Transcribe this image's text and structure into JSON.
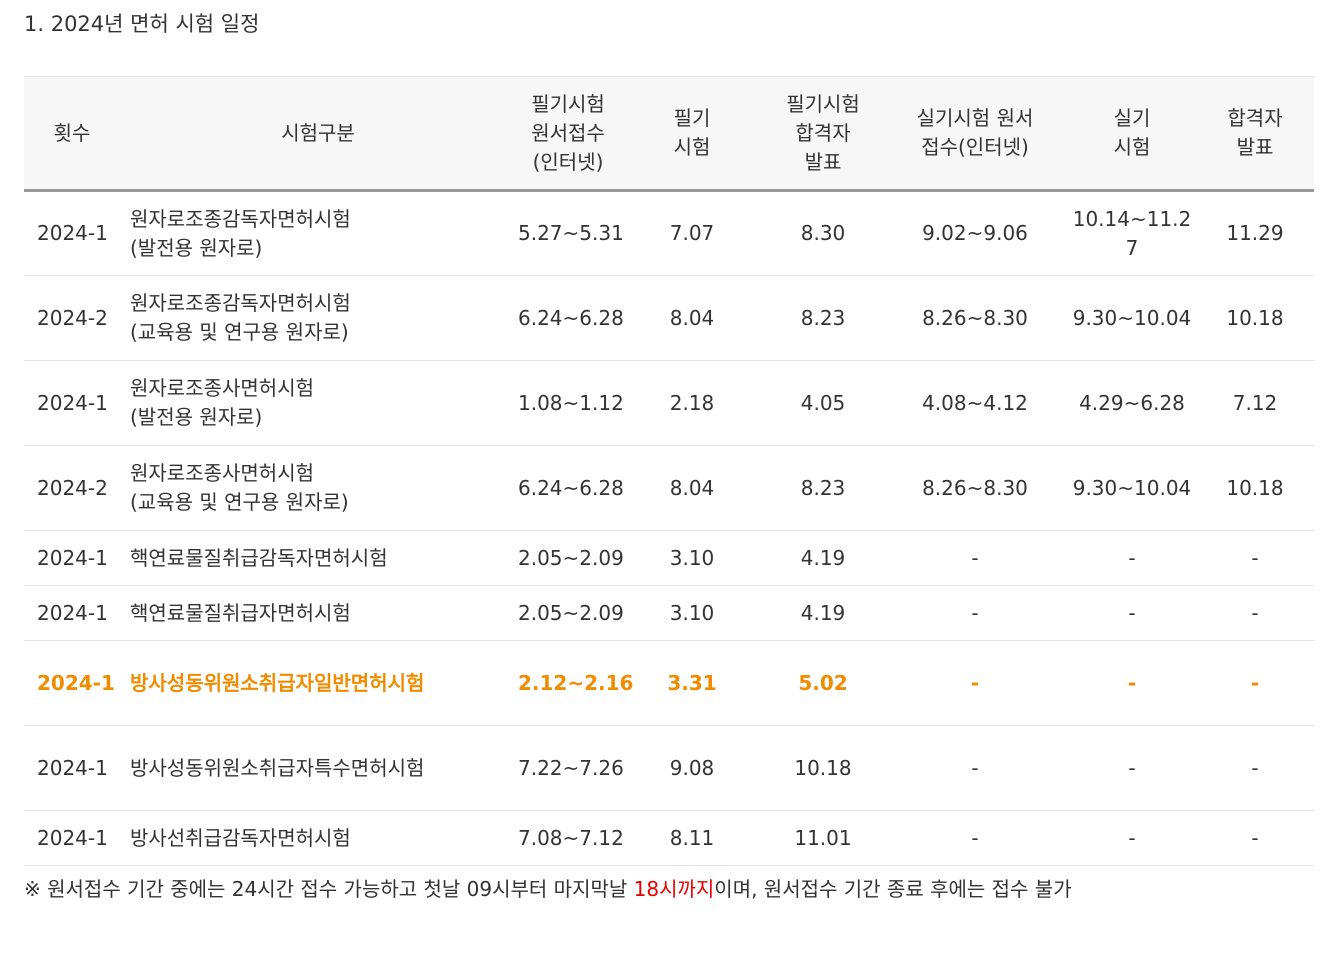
{
  "title": "1. 2024년 면허 시험 일정",
  "table": {
    "headers": {
      "round": "횟수",
      "type": "시험구분",
      "written_apply_l1": "필기시험",
      "written_apply_l2": "원서접수",
      "written_apply_l3": "(인터넷)",
      "written_exam_l1": "필기",
      "written_exam_l2": "시험",
      "written_result_l1": "필기시험",
      "written_result_l2": "합격자",
      "written_result_l3": "발표",
      "practical_apply_l1": "실기시험 원서",
      "practical_apply_l2": "접수(인터넷)",
      "practical_exam_l1": "실기",
      "practical_exam_l2": "시험",
      "final_result_l1": "합격자",
      "final_result_l2": "발표"
    },
    "rows": [
      {
        "round": "2024-1",
        "type1": "원자로조종감독자면허시험",
        "type2": "(발전용 원자로)",
        "written_apply": "5.27~5.31",
        "written_exam": "7.07",
        "written_result": "8.30",
        "practical_apply": "9.02~9.06",
        "practical_exam_l1": "10.14~11.2",
        "practical_exam_l2": "7",
        "final_result": "11.29"
      },
      {
        "round": "2024-2",
        "type1": "원자로조종감독자면허시험",
        "type2": "(교육용 및 연구용 원자로)",
        "written_apply": "6.24~6.28",
        "written_exam": "8.04",
        "written_result": "8.23",
        "practical_apply": "8.26~8.30",
        "practical_exam_l1": "9.30~10.04",
        "practical_exam_l2": "",
        "final_result": "10.18"
      },
      {
        "round": "2024-1",
        "type1": "원자로조종사면허시험",
        "type2": "(발전용 원자로)",
        "written_apply": "1.08~1.12",
        "written_exam": "2.18",
        "written_result": "4.05",
        "practical_apply": "4.08~4.12",
        "practical_exam_l1": "4.29~6.28",
        "practical_exam_l2": "",
        "final_result": "7.12"
      },
      {
        "round": "2024-2",
        "type1": "원자로조종사면허시험",
        "type2": "(교육용 및 연구용 원자로)",
        "written_apply": "6.24~6.28",
        "written_exam": "8.04",
        "written_result": "8.23",
        "practical_apply": "8.26~8.30",
        "practical_exam_l1": "9.30~10.04",
        "practical_exam_l2": "",
        "final_result": "10.18"
      },
      {
        "round": "2024-1",
        "type1": "핵연료물질취급감독자면허시험",
        "type2": "",
        "written_apply": "2.05~2.09",
        "written_exam": "3.10",
        "written_result": "4.19",
        "practical_apply": "-",
        "practical_exam_l1": "-",
        "practical_exam_l2": "",
        "final_result": "-"
      },
      {
        "round": "2024-1",
        "type1": "핵연료물질취급자면허시험",
        "type2": "",
        "written_apply": "2.05~2.09",
        "written_exam": "3.10",
        "written_result": "4.19",
        "practical_apply": "-",
        "practical_exam_l1": "-",
        "practical_exam_l2": "",
        "final_result": "-"
      },
      {
        "round": "2024-1",
        "type1": "방사성동위원소취급자일반면허시험",
        "type2": "",
        "written_apply": "2.12~2.16",
        "written_exam": "3.31",
        "written_result": "5.02",
        "practical_apply": "-",
        "practical_exam_l1": "-",
        "practical_exam_l2": "",
        "final_result": "-"
      },
      {
        "round": "2024-1",
        "type1": "방사성동위원소취급자특수면허시험",
        "type2": "",
        "written_apply": "7.22~7.26",
        "written_exam": "9.08",
        "written_result": "10.18",
        "practical_apply": "-",
        "practical_exam_l1": "-",
        "practical_exam_l2": "",
        "final_result": "-"
      },
      {
        "round": "2024-1",
        "type1": "방사선취급감독자면허시험",
        "type2": "",
        "written_apply": "7.08~7.12",
        "written_exam": "8.11",
        "written_result": "11.01",
        "practical_apply": "-",
        "practical_exam_l1": "-",
        "practical_exam_l2": "",
        "final_result": "-"
      }
    ]
  },
  "footnote": {
    "before": "※ 원서접수 기간 중에는 24시간 접수 가능하고 첫날 09시부터 마지막날 ",
    "highlight": "18시까지",
    "after": "이며, 원서접수 기간 종료 후에는 접수 불가"
  },
  "colors": {
    "highlight_row": "#f08c00",
    "footnote_highlight": "#e60000",
    "header_bg": "#f7f7f7"
  }
}
